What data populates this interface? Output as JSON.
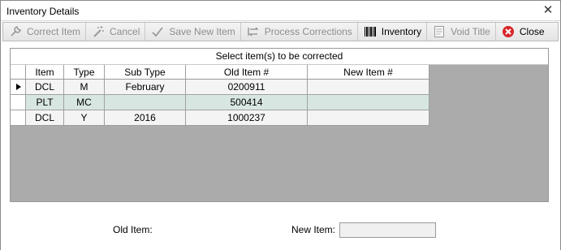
{
  "window": {
    "title": "Inventory Details",
    "close_glyph": "✕"
  },
  "toolbar": {
    "buttons": [
      {
        "label": "Correct Item",
        "icon": "wrench-icon",
        "enabled": false
      },
      {
        "label": "Cancel",
        "icon": "magic-wand-icon",
        "enabled": false
      },
      {
        "label": "Save New Item",
        "icon": "checkmark-icon",
        "enabled": false
      },
      {
        "label": "Process Corrections",
        "icon": "process-arrows-icon",
        "enabled": false
      },
      {
        "label": "Inventory",
        "icon": "barcode-icon",
        "enabled": true
      },
      {
        "label": "Void Title",
        "icon": "document-icon",
        "enabled": false
      },
      {
        "label": "Close",
        "icon": "close-circle-icon",
        "enabled": true
      }
    ]
  },
  "grid": {
    "caption": "Select item(s) to be corrected",
    "columns": [
      "Item",
      "Type",
      "Sub Type",
      "Old Item #",
      "New Item #"
    ],
    "rows": [
      {
        "item": "DCL",
        "type": "M",
        "sub_type": "February",
        "old_item": "0200911",
        "new_item": "",
        "current": true,
        "selected": false
      },
      {
        "item": "PLT",
        "type": "MC",
        "sub_type": "",
        "old_item": "500414",
        "new_item": "",
        "current": false,
        "selected": true
      },
      {
        "item": "DCL",
        "type": "Y",
        "sub_type": "2016",
        "old_item": "1000237",
        "new_item": "",
        "current": false,
        "selected": false
      }
    ]
  },
  "form": {
    "old_item_label": "Old Item:",
    "old_item_value": "",
    "new_item_label": "New Item:",
    "new_item_value": ""
  },
  "colors": {
    "row_selected": "#d8e6e2",
    "row_normal": "#f4f4f4",
    "grid_background": "#ababab",
    "close_icon_red": "#d9262b"
  }
}
